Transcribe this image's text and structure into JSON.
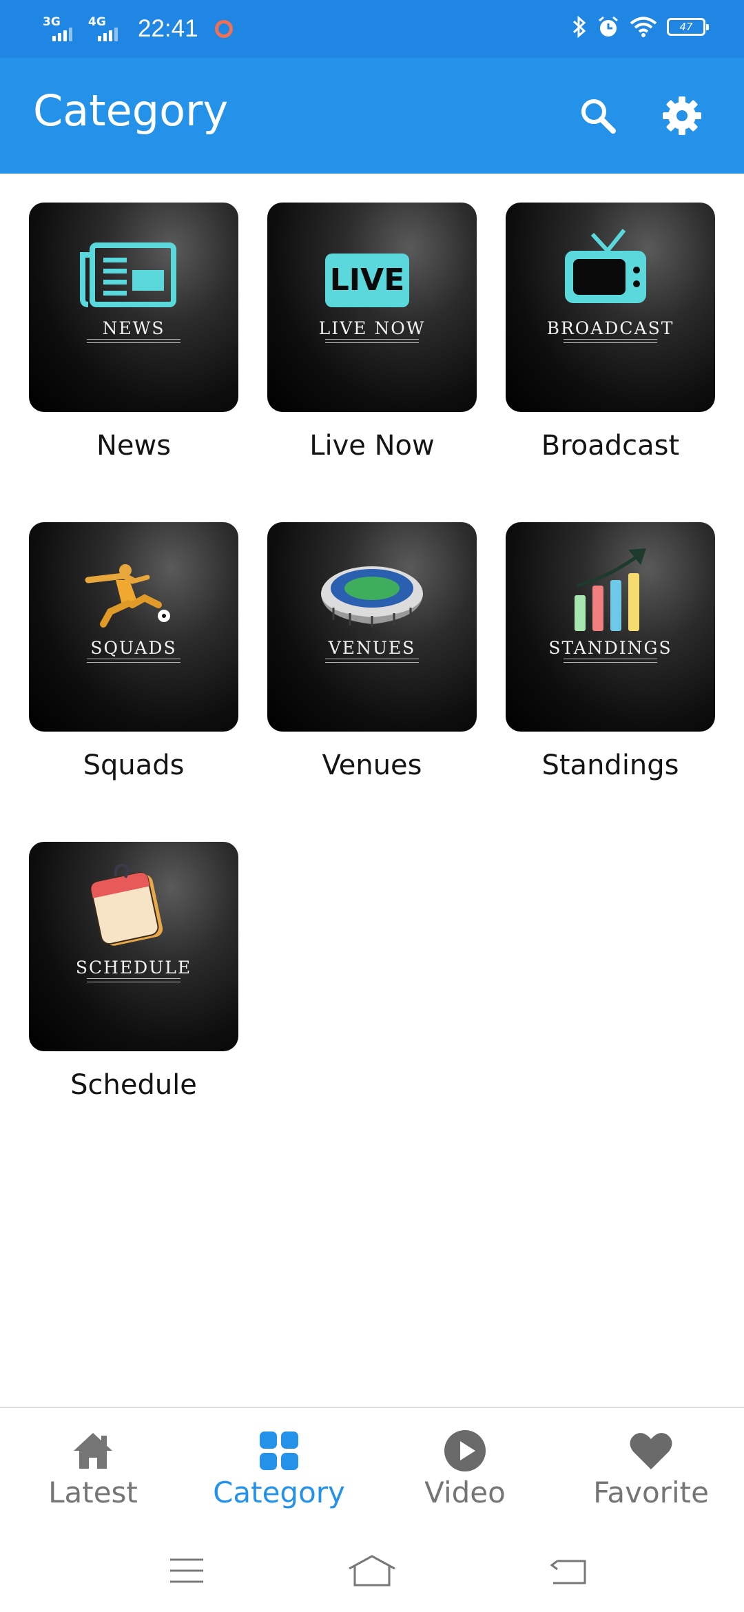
{
  "status_bar": {
    "signal1_label": "3G",
    "signal2_label": "4G",
    "time": "22:41",
    "battery": "47"
  },
  "app_bar": {
    "title": "Category",
    "search_icon": "search-icon",
    "settings_icon": "gear-icon"
  },
  "categories": [
    {
      "card_text": "NEWS",
      "label": "News",
      "icon": "newspaper-icon"
    },
    {
      "card_text": "LIVE NOW",
      "label": "Live Now",
      "icon": "live-badge-icon"
    },
    {
      "card_text": "BROADCAST",
      "label": "Broadcast",
      "icon": "tv-icon"
    },
    {
      "card_text": "SQUADS",
      "label": "Squads",
      "icon": "soccer-player-icon"
    },
    {
      "card_text": "VENUES",
      "label": "Venues",
      "icon": "stadium-icon"
    },
    {
      "card_text": "STANDINGS",
      "label": "Standings",
      "icon": "bar-chart-icon"
    },
    {
      "card_text": "SCHEDULE",
      "label": "Schedule",
      "icon": "calendar-notes-icon"
    }
  ],
  "live_badge_text": "LIVE",
  "bottom_nav": [
    {
      "label": "Latest",
      "icon": "home-icon",
      "active": false
    },
    {
      "label": "Category",
      "icon": "grid-icon",
      "active": true
    },
    {
      "label": "Video",
      "icon": "play-circle-icon",
      "active": false
    },
    {
      "label": "Favorite",
      "icon": "heart-icon",
      "active": false
    }
  ],
  "colors": {
    "status_bar": "#1f86e3",
    "app_bar": "#2592ea",
    "accent_active": "#2592ea",
    "inactive": "#757575",
    "icon_teal": "#5ad8dc"
  }
}
